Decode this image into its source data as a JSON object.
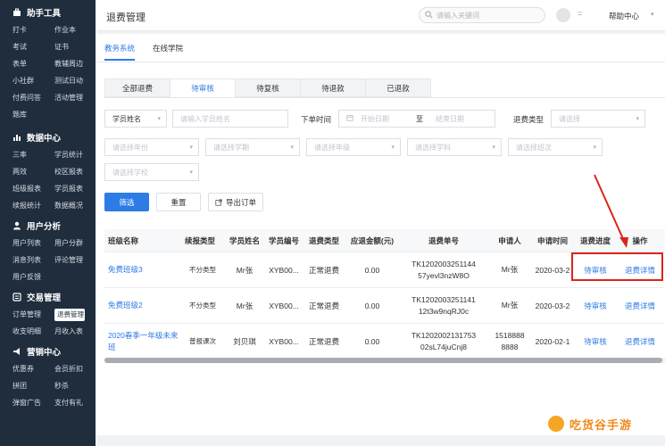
{
  "sidebar": {
    "sections": [
      {
        "title": "助手工具",
        "icon": "toolbox-icon",
        "items": [
          "打卡",
          "作业本",
          "考试",
          "证书",
          "表单",
          "教辅周边",
          "小社群",
          "测试日动",
          "付费问答",
          "活动管理",
          "题库"
        ]
      },
      {
        "title": "数据中心",
        "icon": "chart-icon",
        "items": [
          "三率",
          "学员统计",
          "两效",
          "校区报表",
          "班级报表",
          "学员报表",
          "续报统计",
          "数据概况"
        ]
      },
      {
        "title": "用户分析",
        "icon": "user-icon",
        "items": [
          "用户列表",
          "用户分群",
          "消息列表",
          "评论管理",
          "用户反馈"
        ]
      },
      {
        "title": "交易管理",
        "icon": "trade-icon",
        "items": [
          "订单管理",
          "退费管理",
          "收支明细",
          "月收入表"
        ]
      },
      {
        "title": "营销中心",
        "icon": "megaphone-icon",
        "items": [
          "优惠券",
          "会员折扣",
          "拼团",
          "秒杀",
          "弹窗广告",
          "支付有礼"
        ]
      }
    ],
    "active_item": "退费管理"
  },
  "header": {
    "title": "退费管理",
    "search_placeholder": "请输入关键词",
    "menu_glyph": "=",
    "help": "帮助中心"
  },
  "system_tabs": [
    {
      "label": "教务系统",
      "active": true
    },
    {
      "label": "在线学院",
      "active": false
    }
  ],
  "status_tabs": [
    {
      "label": "全部退费",
      "active": false
    },
    {
      "label": "待审核",
      "active": true
    },
    {
      "label": "待复核",
      "active": false
    },
    {
      "label": "待退款",
      "active": false
    },
    {
      "label": "已退款",
      "active": false
    }
  ],
  "filters": {
    "student_name_select": "学员姓名",
    "student_name_placeholder": "请输入学员姓名",
    "order_time_label": "下单时间",
    "start_date_placeholder": "开始日期",
    "date_sep": "至",
    "end_date_placeholder": "结束日期",
    "refund_type_label": "退费类型",
    "refund_type_placeholder": "请选择",
    "year_placeholder": "请选择年份",
    "term_placeholder": "请选择学期",
    "grade_placeholder": "请选择年级",
    "subject_placeholder": "请选择学科",
    "class_type_placeholder": "请选择班次",
    "school_placeholder": "请选择学校"
  },
  "actions": {
    "filter": "筛选",
    "reset": "重置",
    "export": "导出订单"
  },
  "table": {
    "headers": [
      "班级名称",
      "续报类型",
      "学员姓名",
      "学员编号",
      "退费类型",
      "应退金额(元)",
      "退费单号",
      "申请人",
      "申请时间",
      "退费进度",
      "操作"
    ],
    "rows": [
      {
        "class_name": "免费班级3",
        "renew_type": "不分类型",
        "student": "Mr张",
        "student_no": "XYB00...",
        "refund_type": "正常退费",
        "amount": "0.00",
        "order_no_1": "TK1202003251144",
        "order_no_2": "57yevl3nzW8O",
        "applicant_1": "Mr张",
        "applicant_2": "",
        "apply_time": "2020-03-2",
        "progress": "待审核",
        "action": "退费详情"
      },
      {
        "class_name": "免费班级2",
        "renew_type": "不分类型",
        "student": "Mr张",
        "student_no": "XYB00...",
        "refund_type": "正常退费",
        "amount": "0.00",
        "order_no_1": "TK1202003251141",
        "order_no_2": "12t3w9nqRJ0c",
        "applicant_1": "Mr张",
        "applicant_2": "",
        "apply_time": "2020-03-2",
        "progress": "待审核",
        "action": "退费详情"
      },
      {
        "class_name": "2020春季一年级未来班",
        "renew_type": "普报课次",
        "student": "刘贝琪",
        "student_no": "XYB00...",
        "refund_type": "正常退费",
        "amount": "0.00",
        "order_no_1": "TK1202002131753",
        "order_no_2": "02sL74juCnj8",
        "applicant_1": "1518888",
        "applicant_2": "8888",
        "apply_time": "2020-02-1",
        "progress": "待审核",
        "action": "退费详情"
      }
    ]
  },
  "watermark": "吃货谷手游",
  "colors": {
    "accent": "#2d7be5",
    "sidebar_bg": "#1f2d3d",
    "highlight": "#d9261c"
  }
}
